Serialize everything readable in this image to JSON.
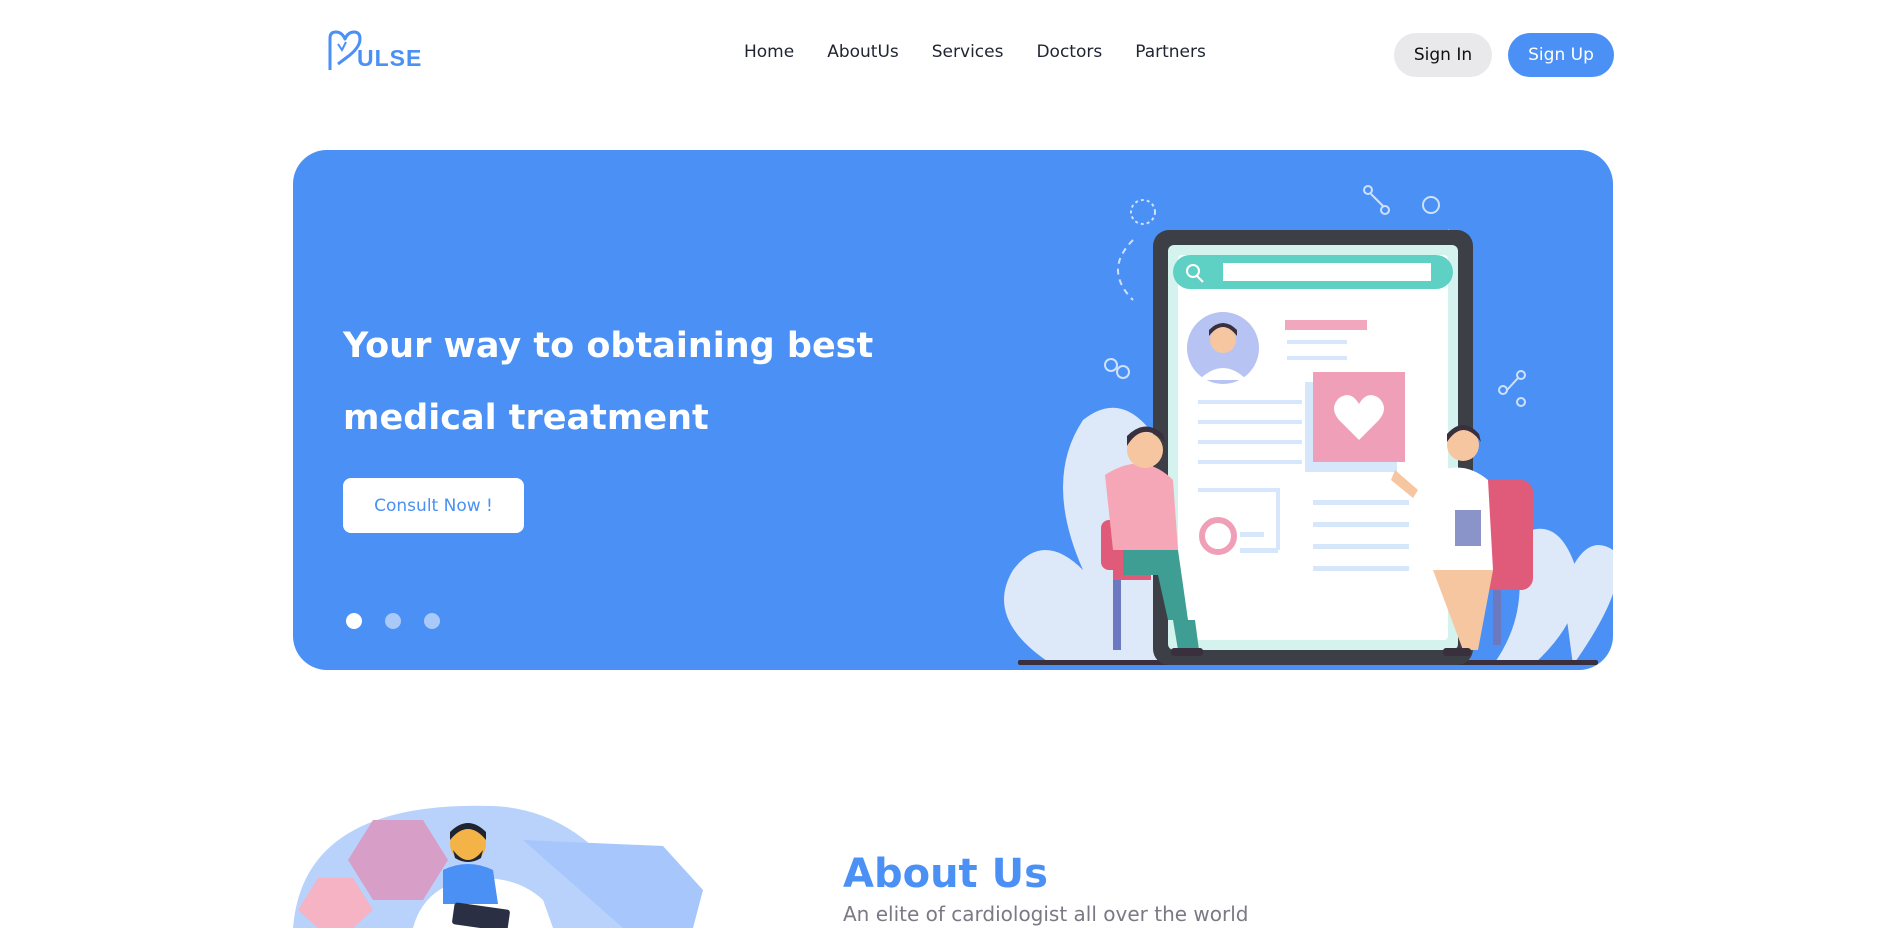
{
  "header": {
    "logo_text": "ULSE",
    "nav": [
      "Home",
      "AboutUs",
      "Services",
      "Doctors",
      "Partners"
    ],
    "sign_in": "Sign In",
    "sign_up": "Sign Up"
  },
  "hero": {
    "title_line1": "Your way to obtaining best",
    "title_line2": "medical treatment",
    "cta": "Consult Now !",
    "slides": 3,
    "active_slide": 1
  },
  "about": {
    "title": "About Us",
    "subtitle": "An elite of cardiologist all over the world"
  },
  "colors": {
    "brand_blue": "#4a90f5",
    "nav_text": "#1f2430",
    "signin_bg": "#e9e9ec"
  }
}
